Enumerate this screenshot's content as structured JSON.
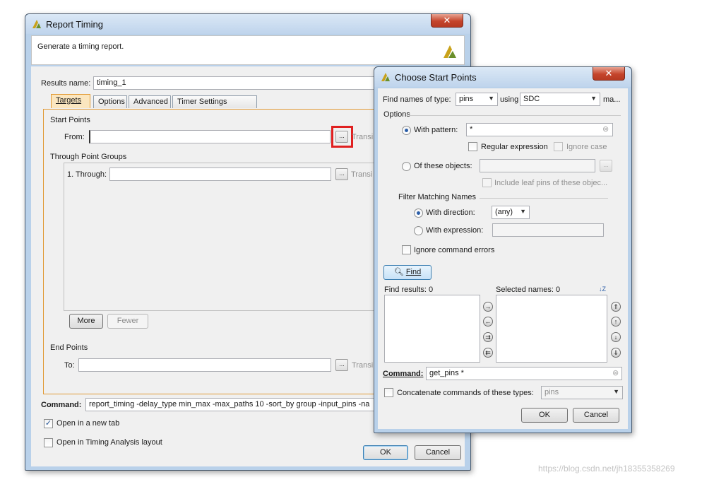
{
  "report_timing": {
    "title": "Report Timing",
    "close_glyph": "✕",
    "description": "Generate a timing report.",
    "results_name_label": "Results name:",
    "results_name_value": "timing_1",
    "tabs": [
      "Targets",
      "Options",
      "Advanced",
      "Timer Settings"
    ],
    "start_points_title": "Start Points",
    "from_label": "From:",
    "from_value": "",
    "dots_label": "...",
    "transition_label": "Transi",
    "through_groups_title": "Through Point Groups",
    "through_label": "1. Through:",
    "through_value": "",
    "more_label": "More",
    "fewer_label": "Fewer",
    "end_points_title": "End Points",
    "to_label": "To:",
    "to_value": "",
    "command_label": "Command:",
    "command_value": "report_timing -delay_type min_max -max_paths 10 -sort_by group -input_pins -na",
    "open_new_tab_label": "Open in a new tab",
    "open_new_tab_checked": true,
    "open_timing_layout_label": "Open in Timing Analysis layout",
    "open_timing_layout_checked": false,
    "ok_label": "OK",
    "cancel_label": "Cancel",
    "highlight_color": "#e02020"
  },
  "choose_start_points": {
    "title": "Choose Start Points",
    "close_glyph": "✕",
    "find_names_label": "Find names of type:",
    "type_value": "pins",
    "using_label": "using",
    "using_value": "SDC",
    "more_text": "ma...",
    "options_title": "Options",
    "with_pattern_label": "With pattern:",
    "pattern_value": "*",
    "regular_expression_label": "Regular expression",
    "ignore_case_label": "Ignore case",
    "of_these_objects_label": "Of these objects:",
    "include_leaf_pins_label": "Include leaf pins of these objec...",
    "filter_title": "Filter Matching Names",
    "with_direction_label": "With direction:",
    "direction_value": "(any)",
    "with_expression_label": "With expression:",
    "ignore_errors_label": "Ignore command errors",
    "find_label": "Find",
    "find_results_label": "Find results: 0",
    "selected_names_label": "Selected names: 0",
    "sort_glyph": "↓Z",
    "command_label": "Command:",
    "command_value": "get_pins *",
    "concatenate_label": "Concatenate commands of these types:",
    "concat_value": "pins",
    "ok_label": "OK",
    "cancel_label": "Cancel"
  },
  "watermark": "https://blog.csdn.net/jh18355358269",
  "colors": {
    "tab_active": "#fbe6bf",
    "targets_border": "#e19a35",
    "close_button": "#c5452c",
    "logo": "#c9a21a"
  }
}
